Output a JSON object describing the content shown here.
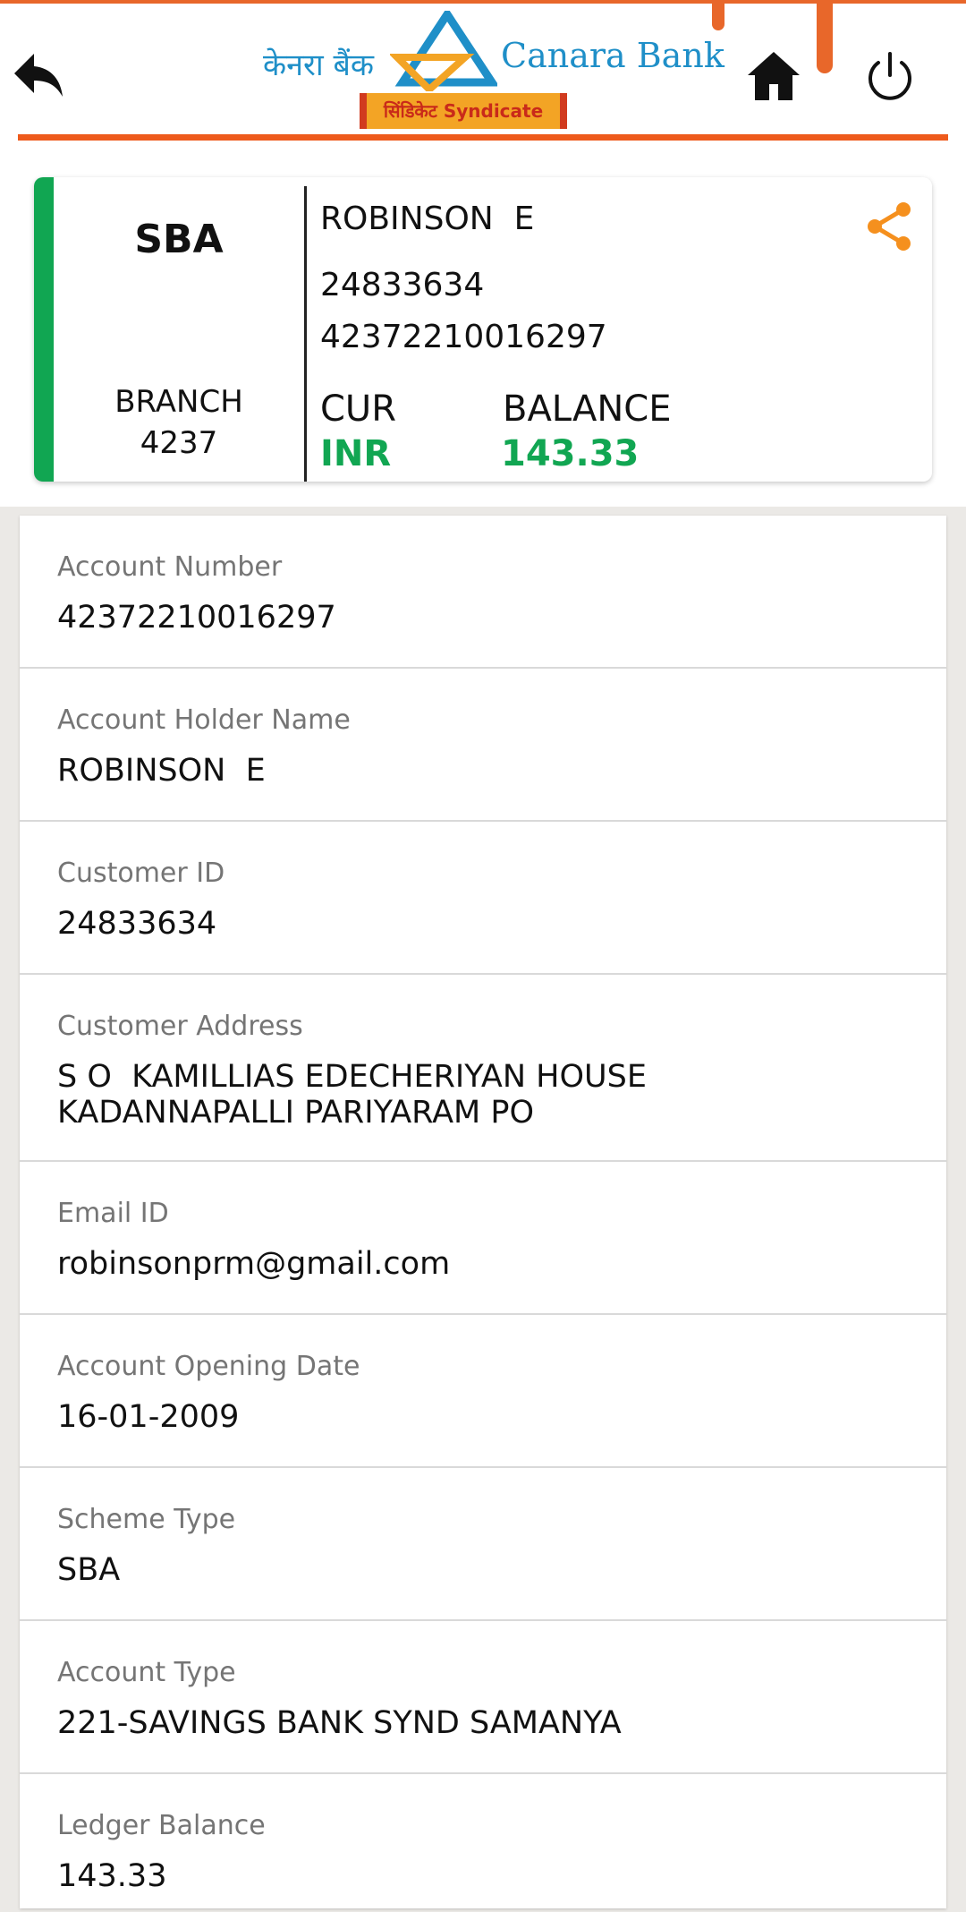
{
  "header": {
    "logo_hindi": "केनरा बैंक",
    "logo_english": "Canara Bank",
    "logo_syndicate": "सिंडिकेट Syndicate",
    "back_icon": "back-arrow-icon",
    "home_icon": "home-icon",
    "power_icon": "power-icon",
    "accent_color": "#ee5a1c"
  },
  "summary": {
    "scheme": "SBA",
    "branch_label": "BRANCH",
    "branch_code": "4237",
    "holder_name": "ROBINSON  E",
    "customer_id": "24833634",
    "account_number": "42372210016297",
    "currency_label": "CUR",
    "currency": "INR",
    "balance_label": "BALANCE",
    "balance": "143.33",
    "share_icon": "share-icon",
    "accent_color": "#11a652"
  },
  "details": [
    {
      "label": "Account Number",
      "value": "42372210016297"
    },
    {
      "label": "Account Holder Name",
      "value": "ROBINSON  E"
    },
    {
      "label": "Customer ID",
      "value": "24833634"
    },
    {
      "label": "Customer Address",
      "value": "S O  KAMILLIAS EDECHERIYAN HOUSE\nKADANNAPALLI PARIYARAM PO"
    },
    {
      "label": "Email ID",
      "value": "robinsonprm@gmail.com"
    },
    {
      "label": "Account Opening Date",
      "value": "16-01-2009"
    },
    {
      "label": "Scheme Type",
      "value": "SBA"
    },
    {
      "label": "Account Type",
      "value": "221-SAVINGS BANK SYND SAMANYA"
    },
    {
      "label": "Ledger Balance",
      "value": "143.33"
    }
  ]
}
